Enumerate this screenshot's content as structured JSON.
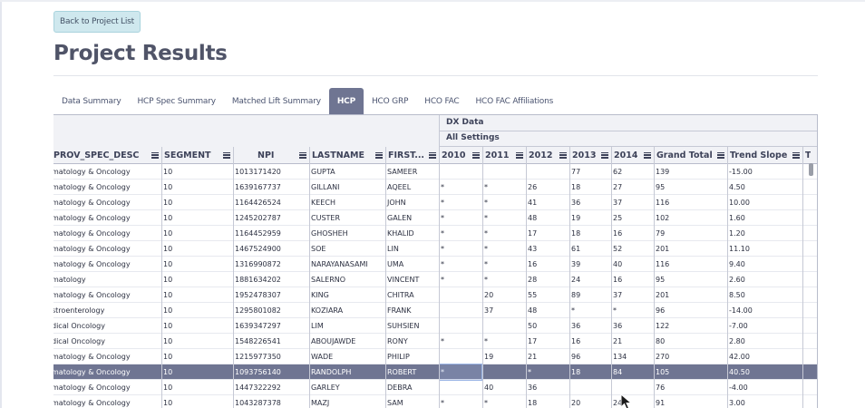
{
  "back_button": "Back to Project List",
  "page_title": "Project Results",
  "tabs": [
    {
      "label": "Data Summary",
      "active": false
    },
    {
      "label": "HCP Spec Summary",
      "active": false
    },
    {
      "label": "Matched Lift Summary",
      "active": false
    },
    {
      "label": "HCP",
      "active": true
    },
    {
      "label": "HCO GRP",
      "active": false
    },
    {
      "label": "HCO FAC",
      "active": false
    },
    {
      "label": "HCO FAC Affiliations",
      "active": false
    }
  ],
  "group_headers": {
    "dx_data": "DX Data",
    "all_settings": "All Settings"
  },
  "columns": [
    "PROV_SPEC_DESC",
    "SEGMENT",
    "NPI",
    "LASTNAME",
    "FIRST...",
    "2010",
    "2011",
    "2012",
    "2013",
    "2014",
    "Grand Total",
    "Trend Slope",
    "T"
  ],
  "rows": [
    [
      "matology & Oncology",
      "10",
      "1013171420",
      "GUPTA",
      "SAMEER",
      "",
      "",
      "",
      "77",
      "62",
      "139",
      "-15.00"
    ],
    [
      "matology & Oncology",
      "10",
      "1639167737",
      "GILLANI",
      "AQEEL",
      "*",
      "*",
      "26",
      "18",
      "27",
      "95",
      "4.50"
    ],
    [
      "matology & Oncology",
      "10",
      "1164426524",
      "KEECH",
      "JOHN",
      "*",
      "*",
      "41",
      "36",
      "37",
      "116",
      "10.00"
    ],
    [
      "matology & Oncology",
      "10",
      "1245202787",
      "CUSTER",
      "GALEN",
      "*",
      "*",
      "48",
      "19",
      "25",
      "102",
      "1.60"
    ],
    [
      "matology & Oncology",
      "10",
      "1164452959",
      "GHOSHEH",
      "KHALID",
      "*",
      "*",
      "17",
      "18",
      "16",
      "79",
      "1.20"
    ],
    [
      "matology & Oncology",
      "10",
      "1467524900",
      "SOE",
      "LIN",
      "*",
      "*",
      "43",
      "61",
      "52",
      "201",
      "11.10"
    ],
    [
      "matology & Oncology",
      "10",
      "1316990872",
      "NARAYANASAMI",
      "UMA",
      "*",
      "*",
      "16",
      "39",
      "40",
      "116",
      "9.40"
    ],
    [
      "matology",
      "10",
      "1881634202",
      "SALERNO",
      "VINCENT",
      "*",
      "*",
      "28",
      "24",
      "16",
      "95",
      "2.60"
    ],
    [
      "matology & Oncology",
      "10",
      "1952478307",
      "KING",
      "CHITRA",
      "",
      "20",
      "55",
      "89",
      "37",
      "201",
      "8.50"
    ],
    [
      "stroenterology",
      "10",
      "1295801082",
      "KOZIARA",
      "FRANK",
      "",
      "37",
      "48",
      "*",
      "*",
      "96",
      "-14.00"
    ],
    [
      "dical Oncology",
      "10",
      "1639347297",
      "LIM",
      "SUHSIEN",
      "",
      "",
      "50",
      "36",
      "36",
      "122",
      "-7.00"
    ],
    [
      "dical Oncology",
      "10",
      "1548226541",
      "ABOUJAWDE",
      "RONY",
      "*",
      "*",
      "17",
      "16",
      "21",
      "80",
      "2.80"
    ],
    [
      "matology & Oncology",
      "10",
      "1215977350",
      "WADE",
      "PHILIP",
      "",
      "19",
      "21",
      "96",
      "134",
      "270",
      "42.00"
    ],
    [
      "matology & Oncology",
      "10",
      "1093756140",
      "RANDOLPH",
      "ROBERT",
      "*",
      "",
      "*",
      "18",
      "84",
      "105",
      "40.50"
    ],
    [
      "matology & Oncology",
      "10",
      "1447322292",
      "GARLEY",
      "DEBRA",
      "",
      "40",
      "36",
      "",
      "",
      "76",
      "-4.00"
    ],
    [
      "matology & Oncology",
      "10",
      "1043287378",
      "MAZJ",
      "SAM",
      "*",
      "*",
      "18",
      "20",
      "24",
      "91",
      "3.00"
    ]
  ],
  "selected_row_index": 13,
  "icons": {
    "column_menu": "hamburger-menu-icon",
    "pointer": "mouse-cursor-icon"
  },
  "colors": {
    "accent": "#6f7592",
    "back_button_bg": "#cfe8ee",
    "title": "#505468",
    "header_bg": "#f1f2f6",
    "selected_row": "#6f7592"
  }
}
